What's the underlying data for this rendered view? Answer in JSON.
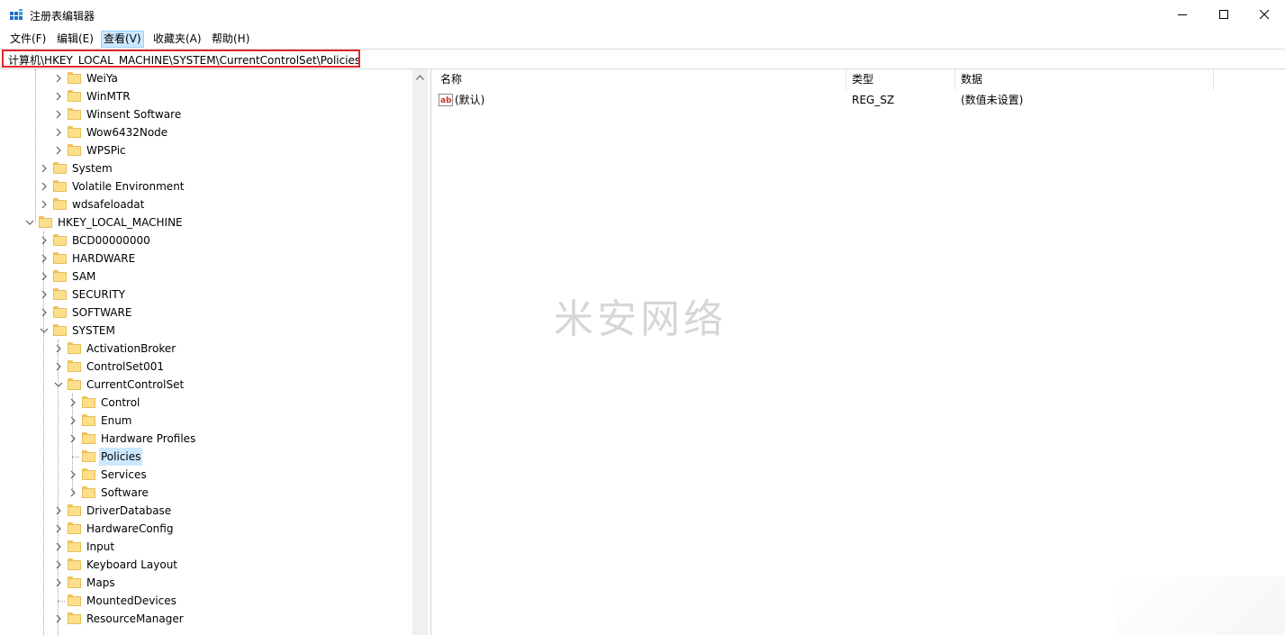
{
  "window": {
    "title": "注册表编辑器",
    "icon": "regedit-icon"
  },
  "menu": [
    {
      "label": "文件(F)"
    },
    {
      "label": "编辑(E)"
    },
    {
      "label": "查看(V)"
    },
    {
      "label": "收藏夹(A)"
    },
    {
      "label": "帮助(H)"
    }
  ],
  "address": {
    "value": "计算机\\HKEY_LOCAL_MACHINE\\SYSTEM\\CurrentControlSet\\Policies"
  },
  "tree": [
    {
      "label": "WeiYa",
      "expander": "collapsed"
    },
    {
      "label": "WinMTR",
      "expander": "collapsed"
    },
    {
      "label": "Winsent Software",
      "expander": "collapsed"
    },
    {
      "label": "Wow6432Node",
      "expander": "collapsed"
    },
    {
      "label": "WPSPic",
      "expander": "collapsed"
    },
    {
      "label": "System",
      "expander": "collapsed"
    },
    {
      "label": "Volatile Environment",
      "expander": "collapsed"
    },
    {
      "label": "wdsafeloadat",
      "expander": "collapsed"
    },
    {
      "label": "HKEY_LOCAL_MACHINE",
      "expander": "expanded"
    },
    {
      "label": "BCD00000000",
      "expander": "collapsed"
    },
    {
      "label": "HARDWARE",
      "expander": "collapsed"
    },
    {
      "label": "SAM",
      "expander": "collapsed"
    },
    {
      "label": "SECURITY",
      "expander": "collapsed"
    },
    {
      "label": "SOFTWARE",
      "expander": "collapsed"
    },
    {
      "label": "SYSTEM",
      "expander": "expanded"
    },
    {
      "label": "ActivationBroker",
      "expander": "collapsed"
    },
    {
      "label": "ControlSet001",
      "expander": "collapsed"
    },
    {
      "label": "CurrentControlSet",
      "expander": "expanded"
    },
    {
      "label": "Control",
      "expander": "collapsed"
    },
    {
      "label": "Enum",
      "expander": "collapsed"
    },
    {
      "label": "Hardware Profiles",
      "expander": "collapsed"
    },
    {
      "label": "Policies",
      "expander": "none",
      "selected": true
    },
    {
      "label": "Services",
      "expander": "collapsed"
    },
    {
      "label": "Software",
      "expander": "collapsed"
    },
    {
      "label": "DriverDatabase",
      "expander": "collapsed"
    },
    {
      "label": "HardwareConfig",
      "expander": "collapsed"
    },
    {
      "label": "Input",
      "expander": "collapsed"
    },
    {
      "label": "Keyboard Layout",
      "expander": "collapsed"
    },
    {
      "label": "Maps",
      "expander": "collapsed"
    },
    {
      "label": "MountedDevices",
      "expander": "none"
    },
    {
      "label": "ResourceManager",
      "expander": "collapsed"
    }
  ],
  "list": {
    "columns": [
      "名称",
      "类型",
      "数据"
    ],
    "rows": [
      {
        "name": "(默认)",
        "type": "REG_SZ",
        "data": "(数值未设置)",
        "icon": "string-value-icon"
      }
    ]
  },
  "watermark": "米安网络",
  "colors": {
    "selection": "#cce8ff",
    "address_highlight": "#e0282e",
    "folder": "#fcdf8a"
  }
}
